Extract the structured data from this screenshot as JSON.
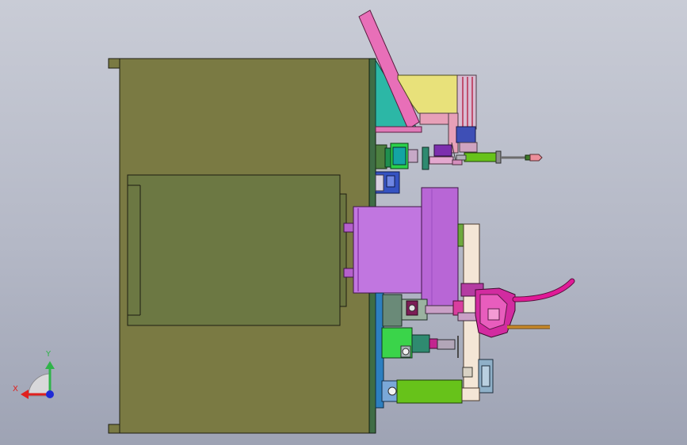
{
  "viewport": {
    "background_top": "#c9ccd6",
    "background_bottom": "#9ea3b4"
  },
  "triad": {
    "x_label": "X",
    "y_label": "Y",
    "x_color": "#e0201e",
    "y_color": "#2fb34a",
    "z_color": "#1f2ad6"
  },
  "palette": {
    "mold_base": "#7a7a43",
    "cavity_plate": "#6c7843",
    "mount_plate": "#3f6d45",
    "nozzle_cylinder": "#c176e0",
    "nozzle_flange": "#b866d6",
    "chute_pink": "#e86fb8",
    "guard_teal": "#2cb7a6",
    "feeder_yellow": "#e8e17a",
    "hose_magenta": "#e01a97",
    "cylinder_green": "#67c21a",
    "rod_orange": "#c98a2a",
    "slide_beige": "#f4e6d6"
  }
}
